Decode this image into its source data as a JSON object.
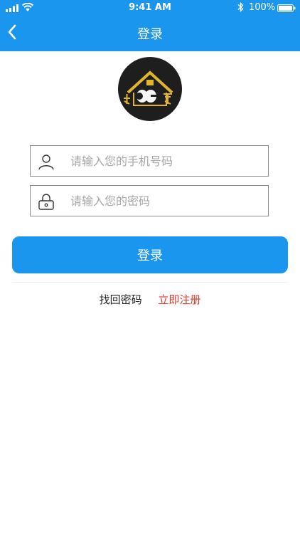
{
  "status": {
    "time": "9:41 AM",
    "battery": "100%"
  },
  "nav": {
    "title": "登录"
  },
  "form": {
    "phone_placeholder": "请输入您的手机号码",
    "password_placeholder": "请输入您的密码",
    "login_label": "登录"
  },
  "links": {
    "forgot": "找回密码",
    "register": "立即注册"
  },
  "colors": {
    "accent": "#1a96ee",
    "register": "#e23a2c",
    "logo_gold": "#e0b52b",
    "logo_bg": "#1e1e1e"
  },
  "icons": [
    "signal-icon",
    "wifi-icon",
    "bluetooth-icon",
    "battery-icon",
    "back-chevron-icon",
    "user-icon",
    "lock-icon"
  ]
}
